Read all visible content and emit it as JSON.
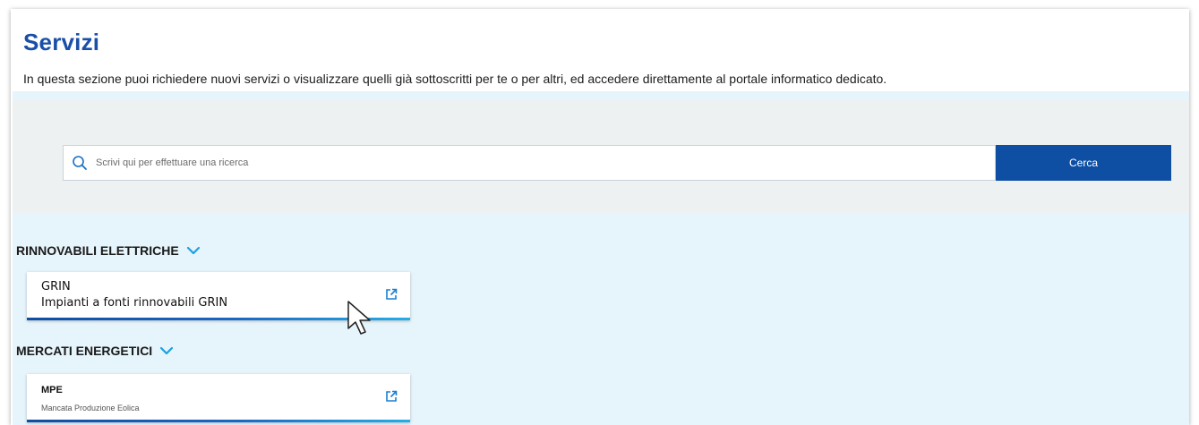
{
  "page": {
    "title": "Servizi",
    "intro": "In questa sezione puoi richiedere nuovi servizi o visualizzare quelli già sottoscritti per te o per altri, ed accedere direttamente al portale informatico dedicato."
  },
  "search": {
    "placeholder": "Scrivi qui per effettuare una ricerca",
    "icon": "search-icon",
    "button_label": "Cerca"
  },
  "categories": [
    {
      "title": "RINNOVABILI ELETTRICHE",
      "icon": "chevron-down-icon",
      "services": [
        {
          "code": "GRIN",
          "name": "Impianti a fonti rinnovabili GRIN",
          "icon": "external-link-icon"
        }
      ]
    },
    {
      "title": "MERCATI ENERGETICI",
      "icon": "chevron-down-icon",
      "services": [
        {
          "code": "MPE",
          "name": "Mancata Produzione Eolica",
          "icon": "external-link-icon"
        }
      ]
    }
  ],
  "colors": {
    "title": "#1a4fa8",
    "primary_button": "#0e4ea3",
    "accent": "#24aee8",
    "content_background": "#e6f4fb",
    "search_panel_background": "#eef1f2"
  }
}
